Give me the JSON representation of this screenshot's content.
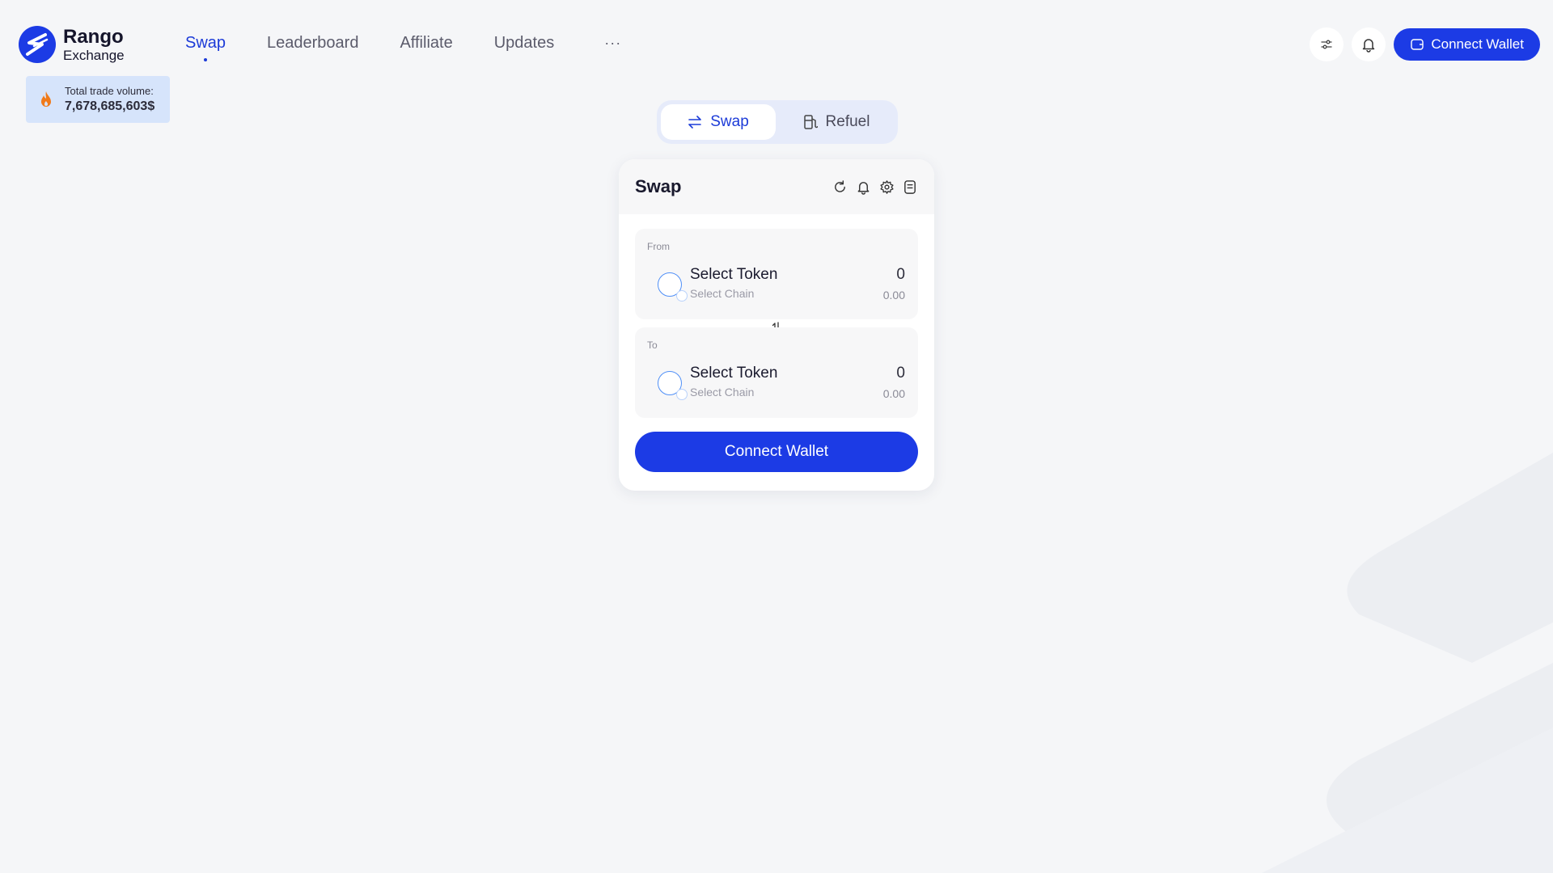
{
  "brand": {
    "name": "Rango",
    "sub": "Exchange"
  },
  "nav": {
    "items": [
      {
        "label": "Swap",
        "active": true
      },
      {
        "label": "Leaderboard",
        "active": false
      },
      {
        "label": "Affiliate",
        "active": false
      },
      {
        "label": "Updates",
        "active": false
      }
    ],
    "more": "···"
  },
  "header": {
    "connect_label": "Connect Wallet",
    "icons": [
      "sliders-icon",
      "bell-icon",
      "wallet-icon"
    ]
  },
  "stats": {
    "label": "Total trade volume:",
    "value": "7,678,685,603$"
  },
  "mode_tabs": {
    "swap": "Swap",
    "refuel": "Refuel",
    "active": "swap"
  },
  "card": {
    "title": "Swap",
    "tools": [
      "refresh-icon",
      "bell-icon",
      "gear-icon",
      "history-icon"
    ],
    "from": {
      "label": "From",
      "token": "Select Token",
      "chain": "Select Chain",
      "amount": "0",
      "usd": "0.00"
    },
    "to": {
      "label": "To",
      "token": "Select Token",
      "chain": "Select Chain",
      "amount": "0",
      "usd": "0.00"
    },
    "connect_label": "Connect Wallet"
  },
  "colors": {
    "accent": "#1c3be5",
    "background": "#f5f6f8",
    "volume_bg": "#d6e4fb",
    "fire": "#f07a1a"
  }
}
